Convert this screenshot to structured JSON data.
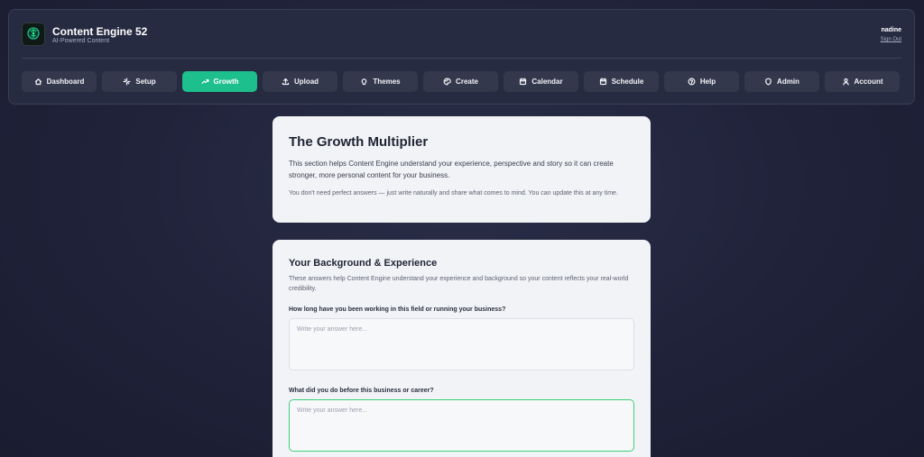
{
  "header": {
    "app_title": "Content Engine 52",
    "app_subtitle": "AI-Powered Content",
    "username": "nadine",
    "sign_out": "Sign Out"
  },
  "nav": [
    {
      "label": "Dashboard",
      "icon": "home-icon"
    },
    {
      "label": "Setup",
      "icon": "sparkle-icon"
    },
    {
      "label": "Growth",
      "icon": "trending-up-icon",
      "active": true
    },
    {
      "label": "Upload",
      "icon": "upload-icon"
    },
    {
      "label": "Themes",
      "icon": "lightbulb-icon"
    },
    {
      "label": "Create",
      "icon": "palette-icon"
    },
    {
      "label": "Calendar",
      "icon": "calendar-icon"
    },
    {
      "label": "Schedule",
      "icon": "calendar-icon"
    },
    {
      "label": "Help",
      "icon": "help-circle-icon"
    },
    {
      "label": "Admin",
      "icon": "shield-icon"
    },
    {
      "label": "Account",
      "icon": "user-icon"
    }
  ],
  "intro": {
    "title": "The Growth Multiplier",
    "body": "This section helps Content Engine understand your experience, perspective and story so it can create stronger, more personal content for your business.",
    "note": "You don't need perfect answers — just write naturally and share what comes to mind. You can update this at any time."
  },
  "background": {
    "title": "Your Background & Experience",
    "description": "These answers help Content Engine understand your experience and background so your content reflects your real-world credibility.",
    "questions": [
      {
        "label": "How long have you been working in this field or running your business?",
        "placeholder": "Write your answer here...",
        "value": ""
      },
      {
        "label": "What did you do before this business or career?",
        "placeholder": "Write your answer here...",
        "value": ""
      }
    ]
  },
  "colors": {
    "accent": "#1dbf8c",
    "focus_border": "#3ecf7a",
    "background": "#1f2239",
    "card": "#f2f3f7"
  }
}
